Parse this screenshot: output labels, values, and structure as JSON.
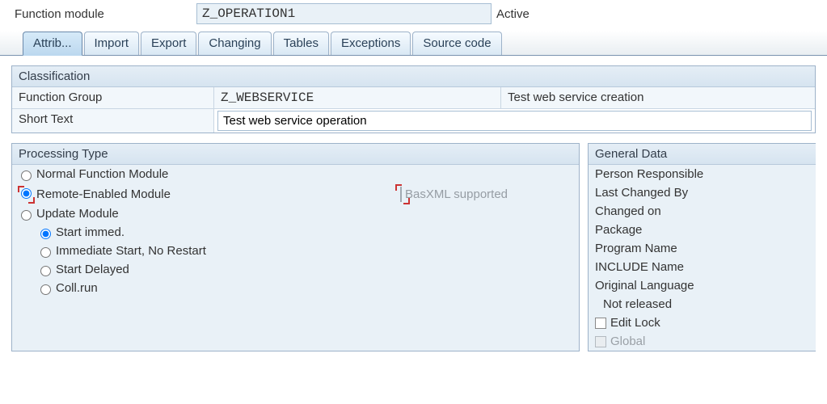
{
  "header": {
    "label": "Function module",
    "name": "Z_OPERATION1",
    "status": "Active"
  },
  "tabs": {
    "attributes": "Attrib...",
    "import": "Import",
    "export": "Export",
    "changing": "Changing",
    "tables": "Tables",
    "exceptions": "Exceptions",
    "source": "Source code"
  },
  "classification": {
    "title": "Classification",
    "fg_label": "Function Group",
    "fg_value": "Z_WEBSERVICE",
    "fg_desc": "Test web service creation",
    "short_label": "Short Text",
    "short_value": "Test web service operation"
  },
  "processing": {
    "title": "Processing Type",
    "normal": "Normal Function Module",
    "remote": "Remote-Enabled Module",
    "basxml": "BasXML supported",
    "update": "Update Module",
    "start_immed": "Start immed.",
    "imm_norestart": "Immediate Start, No Restart",
    "delayed": "Start Delayed",
    "collrun": "Coll.run"
  },
  "general": {
    "title": "General Data",
    "person": "Person Responsible",
    "lastchg": "Last Changed By",
    "chgon": "Changed on",
    "package": "Package",
    "progname": "Program Name",
    "include": "INCLUDE Name",
    "origlang": "Original Language",
    "notreleased": "Not released",
    "editlock": "Edit Lock",
    "global": "Global"
  }
}
